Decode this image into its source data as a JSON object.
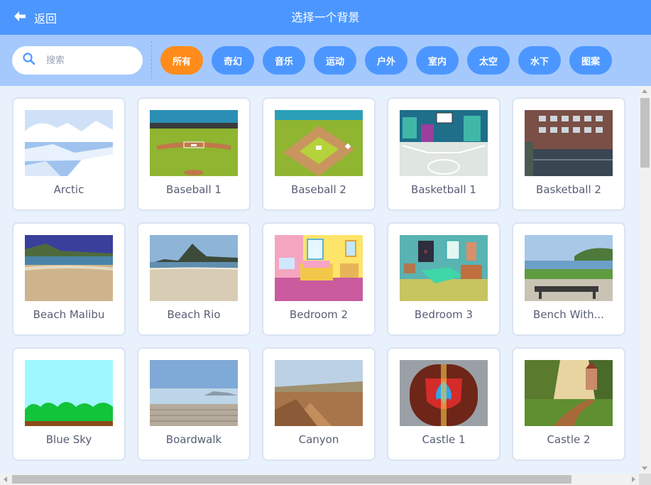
{
  "header": {
    "back_label": "返回",
    "title": "选择一个背景",
    "bg_color": "#4c97ff"
  },
  "search": {
    "placeholder": "搜索",
    "value": ""
  },
  "tags": [
    {
      "label": "所有",
      "active": true
    },
    {
      "label": "奇幻",
      "active": false
    },
    {
      "label": "音乐",
      "active": false
    },
    {
      "label": "运动",
      "active": false
    },
    {
      "label": "户外",
      "active": false
    },
    {
      "label": "室内",
      "active": false
    },
    {
      "label": "太空",
      "active": false
    },
    {
      "label": "水下",
      "active": false
    },
    {
      "label": "图案",
      "active": false
    }
  ],
  "colors": {
    "tag": "#4c97ff",
    "tag_active": "#ff8c1a",
    "filter_bar": "#a5c9fd",
    "content_bg": "#e9f1fc"
  },
  "backdrops": [
    {
      "name": "Arctic",
      "icon": "arctic-thumbnail"
    },
    {
      "name": "Baseball 1",
      "icon": "baseball-1-thumbnail"
    },
    {
      "name": "Baseball 2",
      "icon": "baseball-2-thumbnail"
    },
    {
      "name": "Basketball 1",
      "icon": "basketball-1-thumbnail"
    },
    {
      "name": "Basketball 2",
      "icon": "basketball-2-thumbnail"
    },
    {
      "name": "Beach Malibu",
      "icon": "beach-malibu-thumbnail"
    },
    {
      "name": "Beach Rio",
      "icon": "beach-rio-thumbnail"
    },
    {
      "name": "Bedroom 2",
      "icon": "bedroom-2-thumbnail"
    },
    {
      "name": "Bedroom 3",
      "icon": "bedroom-3-thumbnail"
    },
    {
      "name": "Bench With...",
      "icon": "bench-with-view-thumbnail"
    },
    {
      "name": "Blue Sky",
      "icon": "blue-sky-thumbnail"
    },
    {
      "name": "Boardwalk",
      "icon": "boardwalk-thumbnail"
    },
    {
      "name": "Canyon",
      "icon": "canyon-thumbnail"
    },
    {
      "name": "Castle 1",
      "icon": "castle-1-thumbnail"
    },
    {
      "name": "Castle 2",
      "icon": "castle-2-thumbnail"
    }
  ]
}
